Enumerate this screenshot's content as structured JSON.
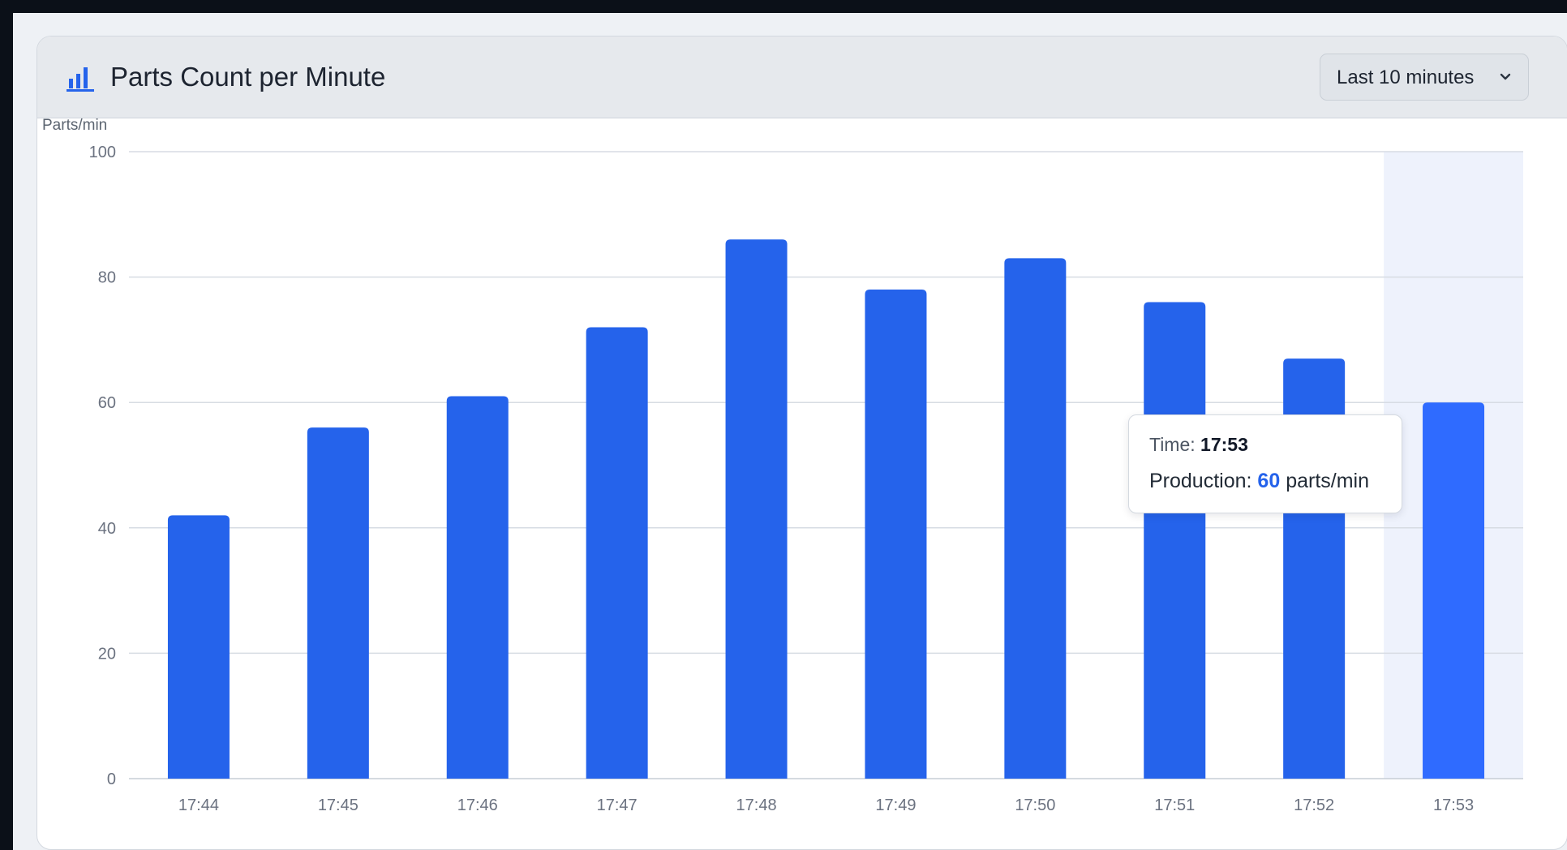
{
  "card": {
    "title": "Parts Count per Minute",
    "icon": "bar-chart-icon"
  },
  "range_select": {
    "value": "Last 10 minutes",
    "icon": "chevron-down-icon"
  },
  "chart_data": {
    "type": "bar",
    "title": "Parts Count per Minute",
    "xlabel": "",
    "ylabel": "Parts/min",
    "categories": [
      "17:44",
      "17:45",
      "17:46",
      "17:47",
      "17:48",
      "17:49",
      "17:50",
      "17:51",
      "17:52",
      "17:53"
    ],
    "values": [
      42,
      56,
      61,
      72,
      86,
      78,
      83,
      76,
      67,
      60
    ],
    "ylim": [
      0,
      100
    ],
    "yticks": [
      0,
      20,
      40,
      60,
      80,
      100
    ],
    "grid": true,
    "legend": "none",
    "highlighted_category": "17:53",
    "colors": {
      "bar": "#2563eb",
      "bar_highlight": "#2f6bff",
      "highlight_band": "#eef2fc",
      "grid": "#d7dce3",
      "tick": "#6b7280"
    }
  },
  "tooltip": {
    "time_label": "Time:",
    "time_value": "17:53",
    "production_label": "Production:",
    "production_value": "60",
    "unit": "parts/min"
  }
}
